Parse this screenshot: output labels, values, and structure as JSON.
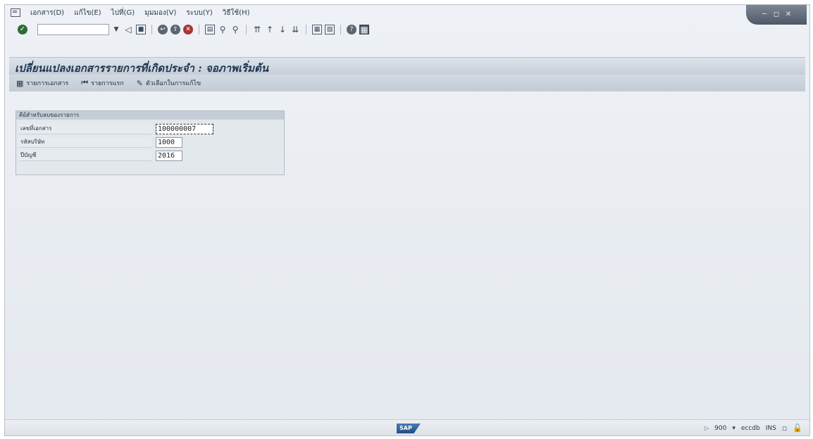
{
  "menubar": {
    "items": [
      {
        "label": "เอกสาร(D)"
      },
      {
        "label": "แก้ไข(E)"
      },
      {
        "label": "ไปที่(G)"
      },
      {
        "label": "มุมมอง(V)"
      },
      {
        "label": "ระบบ(Y)"
      },
      {
        "label": "วิธีใช้(H)"
      }
    ]
  },
  "toolbar": {
    "command_field_value": "",
    "icons": [
      "enter-check-icon",
      "back-icon",
      "save-icon",
      "back-green-icon",
      "exit-icon",
      "cancel-icon",
      "print-icon",
      "find-icon",
      "find-next-icon",
      "first-page-icon",
      "previous-page-icon",
      "next-page-icon",
      "last-page-icon",
      "create-session-icon",
      "shortcut-icon",
      "help-icon",
      "customize-layout-icon"
    ]
  },
  "page": {
    "title": "เปลี่ยนแปลงเอกสารรายการที่เกิดประจำ : จอภาพเริ่มต้น"
  },
  "app_toolbar": {
    "items": [
      {
        "label": "รายการเอกสาร",
        "icon": "document-list-icon"
      },
      {
        "label": "รายการแรก",
        "icon": "first-item-icon"
      },
      {
        "label": "ตัวเลือกในการแก้ไข",
        "icon": "edit-options-icon"
      }
    ]
  },
  "group": {
    "title": "คีย์สำหรับลบของรายการ",
    "fields": [
      {
        "label": "เลขที่เอกสาร",
        "value": "100000007"
      },
      {
        "label": "รหัสบริษัท",
        "value": "1000"
      },
      {
        "label": "ปีบัญชี",
        "value": "2016"
      }
    ]
  },
  "statusbar": {
    "logo": "SAP",
    "client": "900",
    "system": "eccdb",
    "mode": "INS"
  }
}
